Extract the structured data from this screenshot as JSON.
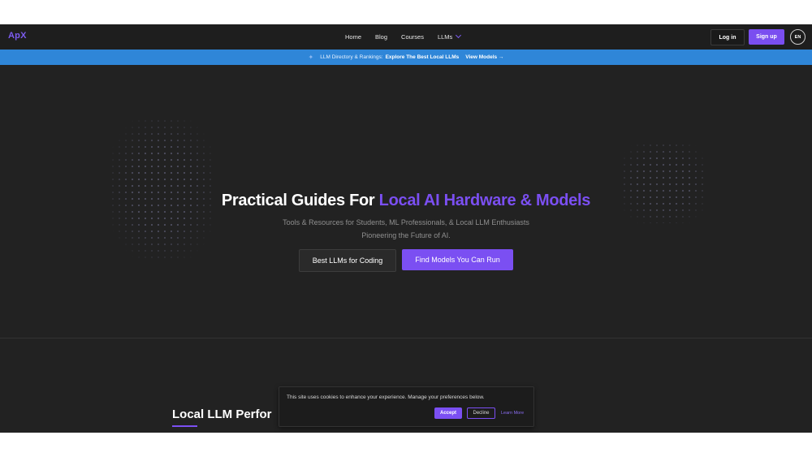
{
  "nav": {
    "logo": "ApX",
    "links": [
      "Home",
      "Blog",
      "Courses",
      "LLMs"
    ],
    "login_label": "Log in",
    "signup_label": "Sign up",
    "lang_label": "EN"
  },
  "banner": {
    "prefix": "LLM Directory & Rankings:",
    "highlight": "Explore The Best Local LLMs",
    "link": "View Models →"
  },
  "hero": {
    "title_plain": "Practical Guides For ",
    "title_accent": "Local AI Hardware & Models",
    "subtitle_line1": "Tools & Resources for Students, ML Professionals, & Local LLM Enthusiasts",
    "subtitle_line2": "Pioneering the Future of AI.",
    "primary_button": "Best LLMs for Coding",
    "secondary_button": "Find Models You Can Run"
  },
  "section": {
    "title": "Local LLM Perfor"
  },
  "cookie": {
    "text": "This site uses cookies to enhance your experience. Manage your preferences below.",
    "accept_label": "Accept",
    "decline_label": "Decline",
    "learn_more_label": "Learn More"
  },
  "colors": {
    "accent": "#7b4ff2",
    "banner_blue": "#2f86d8",
    "background": "#222222"
  }
}
